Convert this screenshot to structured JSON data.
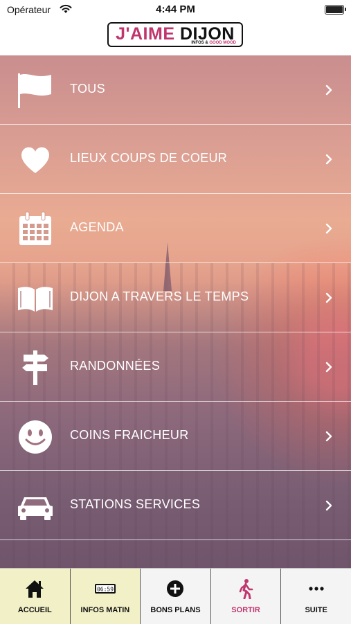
{
  "status_bar": {
    "carrier": "Opérateur",
    "time": "4:44 PM"
  },
  "header": {
    "logo_main_1": "J'AIME",
    "logo_main_2": "DIJON",
    "logo_tag_1": "INFOS & ",
    "logo_tag_2": "GOOD MOOD"
  },
  "menu": {
    "items": [
      {
        "label": "TOUS",
        "icon": "flag-icon"
      },
      {
        "label": "LIEUX COUPS DE COEUR",
        "icon": "heart-icon"
      },
      {
        "label": "AGENDA",
        "icon": "calendar-icon"
      },
      {
        "label": "DIJON A TRAVERS LE TEMPS",
        "icon": "book-icon"
      },
      {
        "label": "RANDONNÉES",
        "icon": "signpost-icon"
      },
      {
        "label": "COINS FRAICHEUR",
        "icon": "smiley-icon"
      },
      {
        "label": "STATIONS SERVICES",
        "icon": "car-icon"
      }
    ]
  },
  "tabbar": {
    "tabs": [
      {
        "label": "ACCUEIL",
        "icon": "home-icon"
      },
      {
        "label": "INFOS MATIN",
        "icon": "clock-display-icon",
        "clock_text": "06:59"
      },
      {
        "label": "BONS PLANS",
        "icon": "plus-circle-icon"
      },
      {
        "label": "SORTIR",
        "icon": "walking-person-icon"
      },
      {
        "label": "SUITE",
        "icon": "more-dots-icon"
      }
    ]
  },
  "colors": {
    "accent_pink": "#c0356e",
    "active_tab_bg": "#f1f0c7"
  }
}
